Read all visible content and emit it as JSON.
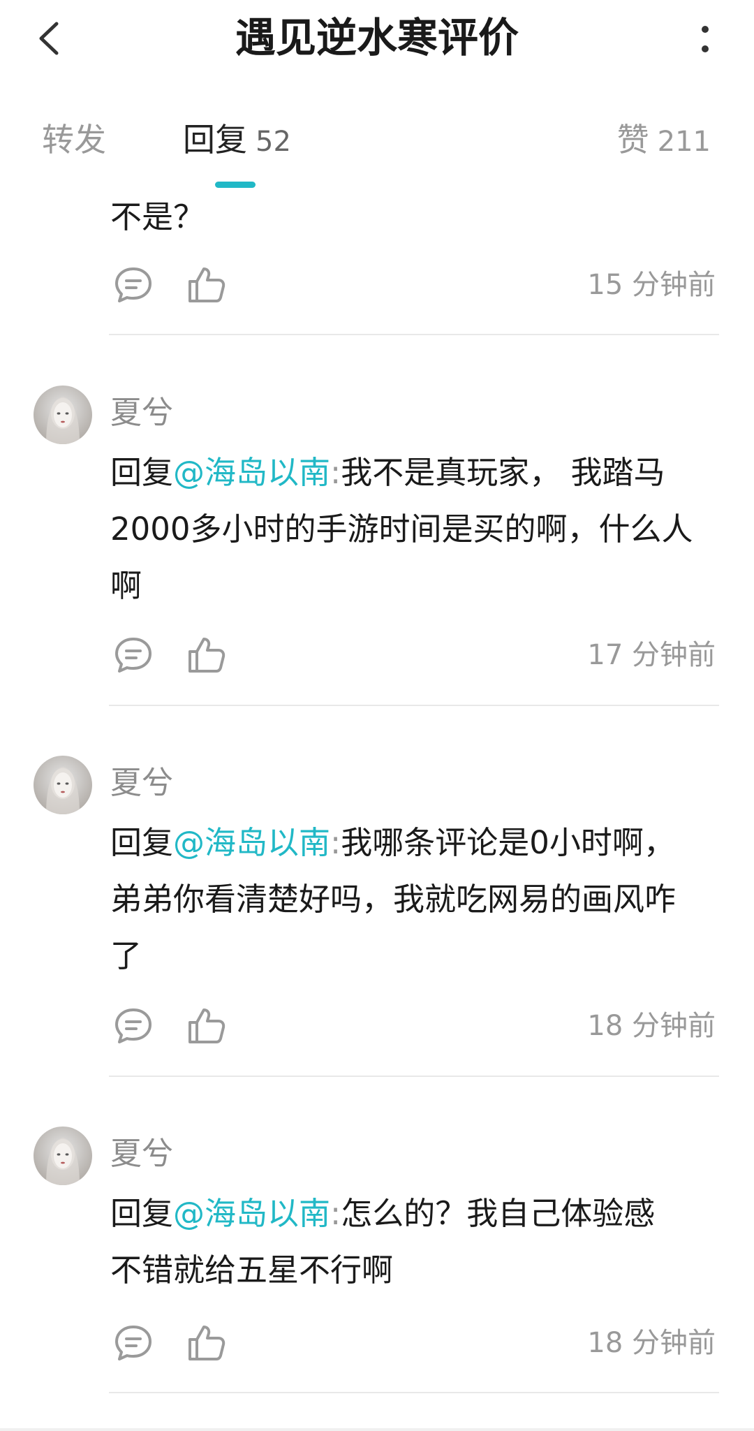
{
  "header": {
    "title": "遇见逆水寒评价",
    "back_icon": "chevron-left-icon",
    "more_icon": "vertical-dots-icon"
  },
  "tabs": {
    "forward_label": "转发",
    "reply_label": "回复",
    "reply_count": "52",
    "like_label": "赞",
    "like_count": "211",
    "active": "reply",
    "accent_color": "#21b8c6"
  },
  "comments": [
    {
      "text": "不是？",
      "time": "15 分钟前"
    },
    {
      "username": "夏兮",
      "reply_prefix": "回复",
      "mention": "@海岛以南",
      "separator": ":",
      "text_line1": "我不是真玩家， 我踏马",
      "text_line2": "2000多小时的手游时间是买的啊，什么人",
      "text_line3": "啊",
      "time": "17 分钟前"
    },
    {
      "username": "夏兮",
      "reply_prefix": "回复",
      "mention": "@海岛以南",
      "separator": ":",
      "text_line1": "我哪条评论是0小时啊，",
      "text_line2": "弟弟你看清楚好吗，我就吃网易的画风咋",
      "text_line3": "了",
      "time": "18 分钟前"
    },
    {
      "username": "夏兮",
      "reply_prefix": "回复",
      "mention": "@海岛以南",
      "separator": ":",
      "text_line1": "怎么的？我自己体验感",
      "text_line2": "不错就给五星不行啊",
      "time": "18 分钟前"
    }
  ],
  "icons": {
    "comment": "comment-bubble-icon",
    "like": "thumbs-up-icon"
  }
}
